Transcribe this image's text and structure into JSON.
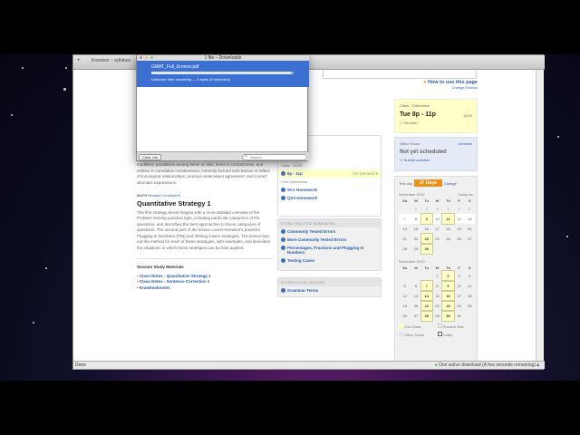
{
  "browser": {
    "tab_title": "Knewton :: syllabus",
    "status_left": "Done",
    "status_right": "One active download (A few seconds remaining)"
  },
  "downloads": {
    "title": "1 file – Downloads",
    "file_name": "GMAT_Full_Errores.pdf",
    "progress": 0.98,
    "status": "Unknown time remaining — 0 bytes (0 bytes/sec)",
    "clear_label": "Clear List",
    "search_placeholder": "Search"
  },
  "main": {
    "intro_text": "modifiers; parallelism among items on lists, items in comparisons, and entities in correlative constructions; correctly-formed verb tenses to reflect chronological relationships; pronoun-antecedent agreement; and correct idiomatic expressions.",
    "math_label": "MATH",
    "related_label": "Related Concepts ▾",
    "lesson_title": "Quantitative Strategy 1",
    "lesson_text": "The first strategy lesson begins with a more detailed overview of the Problem Solving question type, including particular categories of PS questions, and describes the best approaches to those categories of questions. The second part of the lesson covers Knewton's powerful Plugging In Numbers (PIN) and Testing Cases strategies. The lesson lays out the method for each of these strategies, with examples, and describes the situations in which these strategies can be best applied.",
    "materials_title": "Session Study Materials",
    "materials": [
      "Class Notes - Quantitative Strategy 1",
      "Class Notes - Sentence Correction 1",
      "Knowtonknotes"
    ]
  },
  "help": {
    "how_to": "How to use this page",
    "change_section": "Change Section"
  },
  "middle": {
    "partial_items": [
      "...ment",
      "...ment"
    ],
    "class_label": "Class - 11/23",
    "class_time": "8p - 11p",
    "on_demand": "On Demand ▾",
    "core_hw_label": "Core Homework",
    "core_hw": [
      "SC1 Homework",
      "QS3 Homework"
    ],
    "extra_practice_header": "Extra Practice Homework",
    "extra_practice": [
      "Commonly Tested Errors",
      "More Commonly Tested Errors",
      "Percentages, Fractions and Plugging In Numbers",
      "Testing Cases"
    ],
    "extra_focus_header": "Extra Focus Lessons",
    "extra_focus": [
      "Grammar Terms"
    ]
  },
  "right": {
    "class_label": "Class - Orientation",
    "class_time": "Tue 8p - 11p",
    "class_date": "11/09",
    "set_alert": "Set Alert",
    "office_label": "Office Hours",
    "archives": "Archives",
    "office_status": "Not yet scheduled",
    "submit_question": "Submit question",
    "test_day": "Test day",
    "days_left": "37 Days",
    "change": "Change",
    "today": "Today",
    "weekdays": [
      "Su",
      "M",
      "Tu",
      "W",
      "Th",
      "F",
      "S"
    ],
    "months": [
      {
        "name": "November 2010",
        "offset": 1,
        "days": 30,
        "highlight": [
          9,
          11,
          23,
          30
        ],
        "past_until": 6,
        "current_week": [
          7,
          13
        ]
      },
      {
        "name": "December 2010",
        "offset": 3,
        "days": 31,
        "highlight": [
          2,
          7,
          9,
          14,
          16,
          21,
          23,
          28,
          30
        ]
      }
    ],
    "legend": [
      "Live Class",
      "Practice Test",
      "Office Hours",
      "Today"
    ]
  }
}
